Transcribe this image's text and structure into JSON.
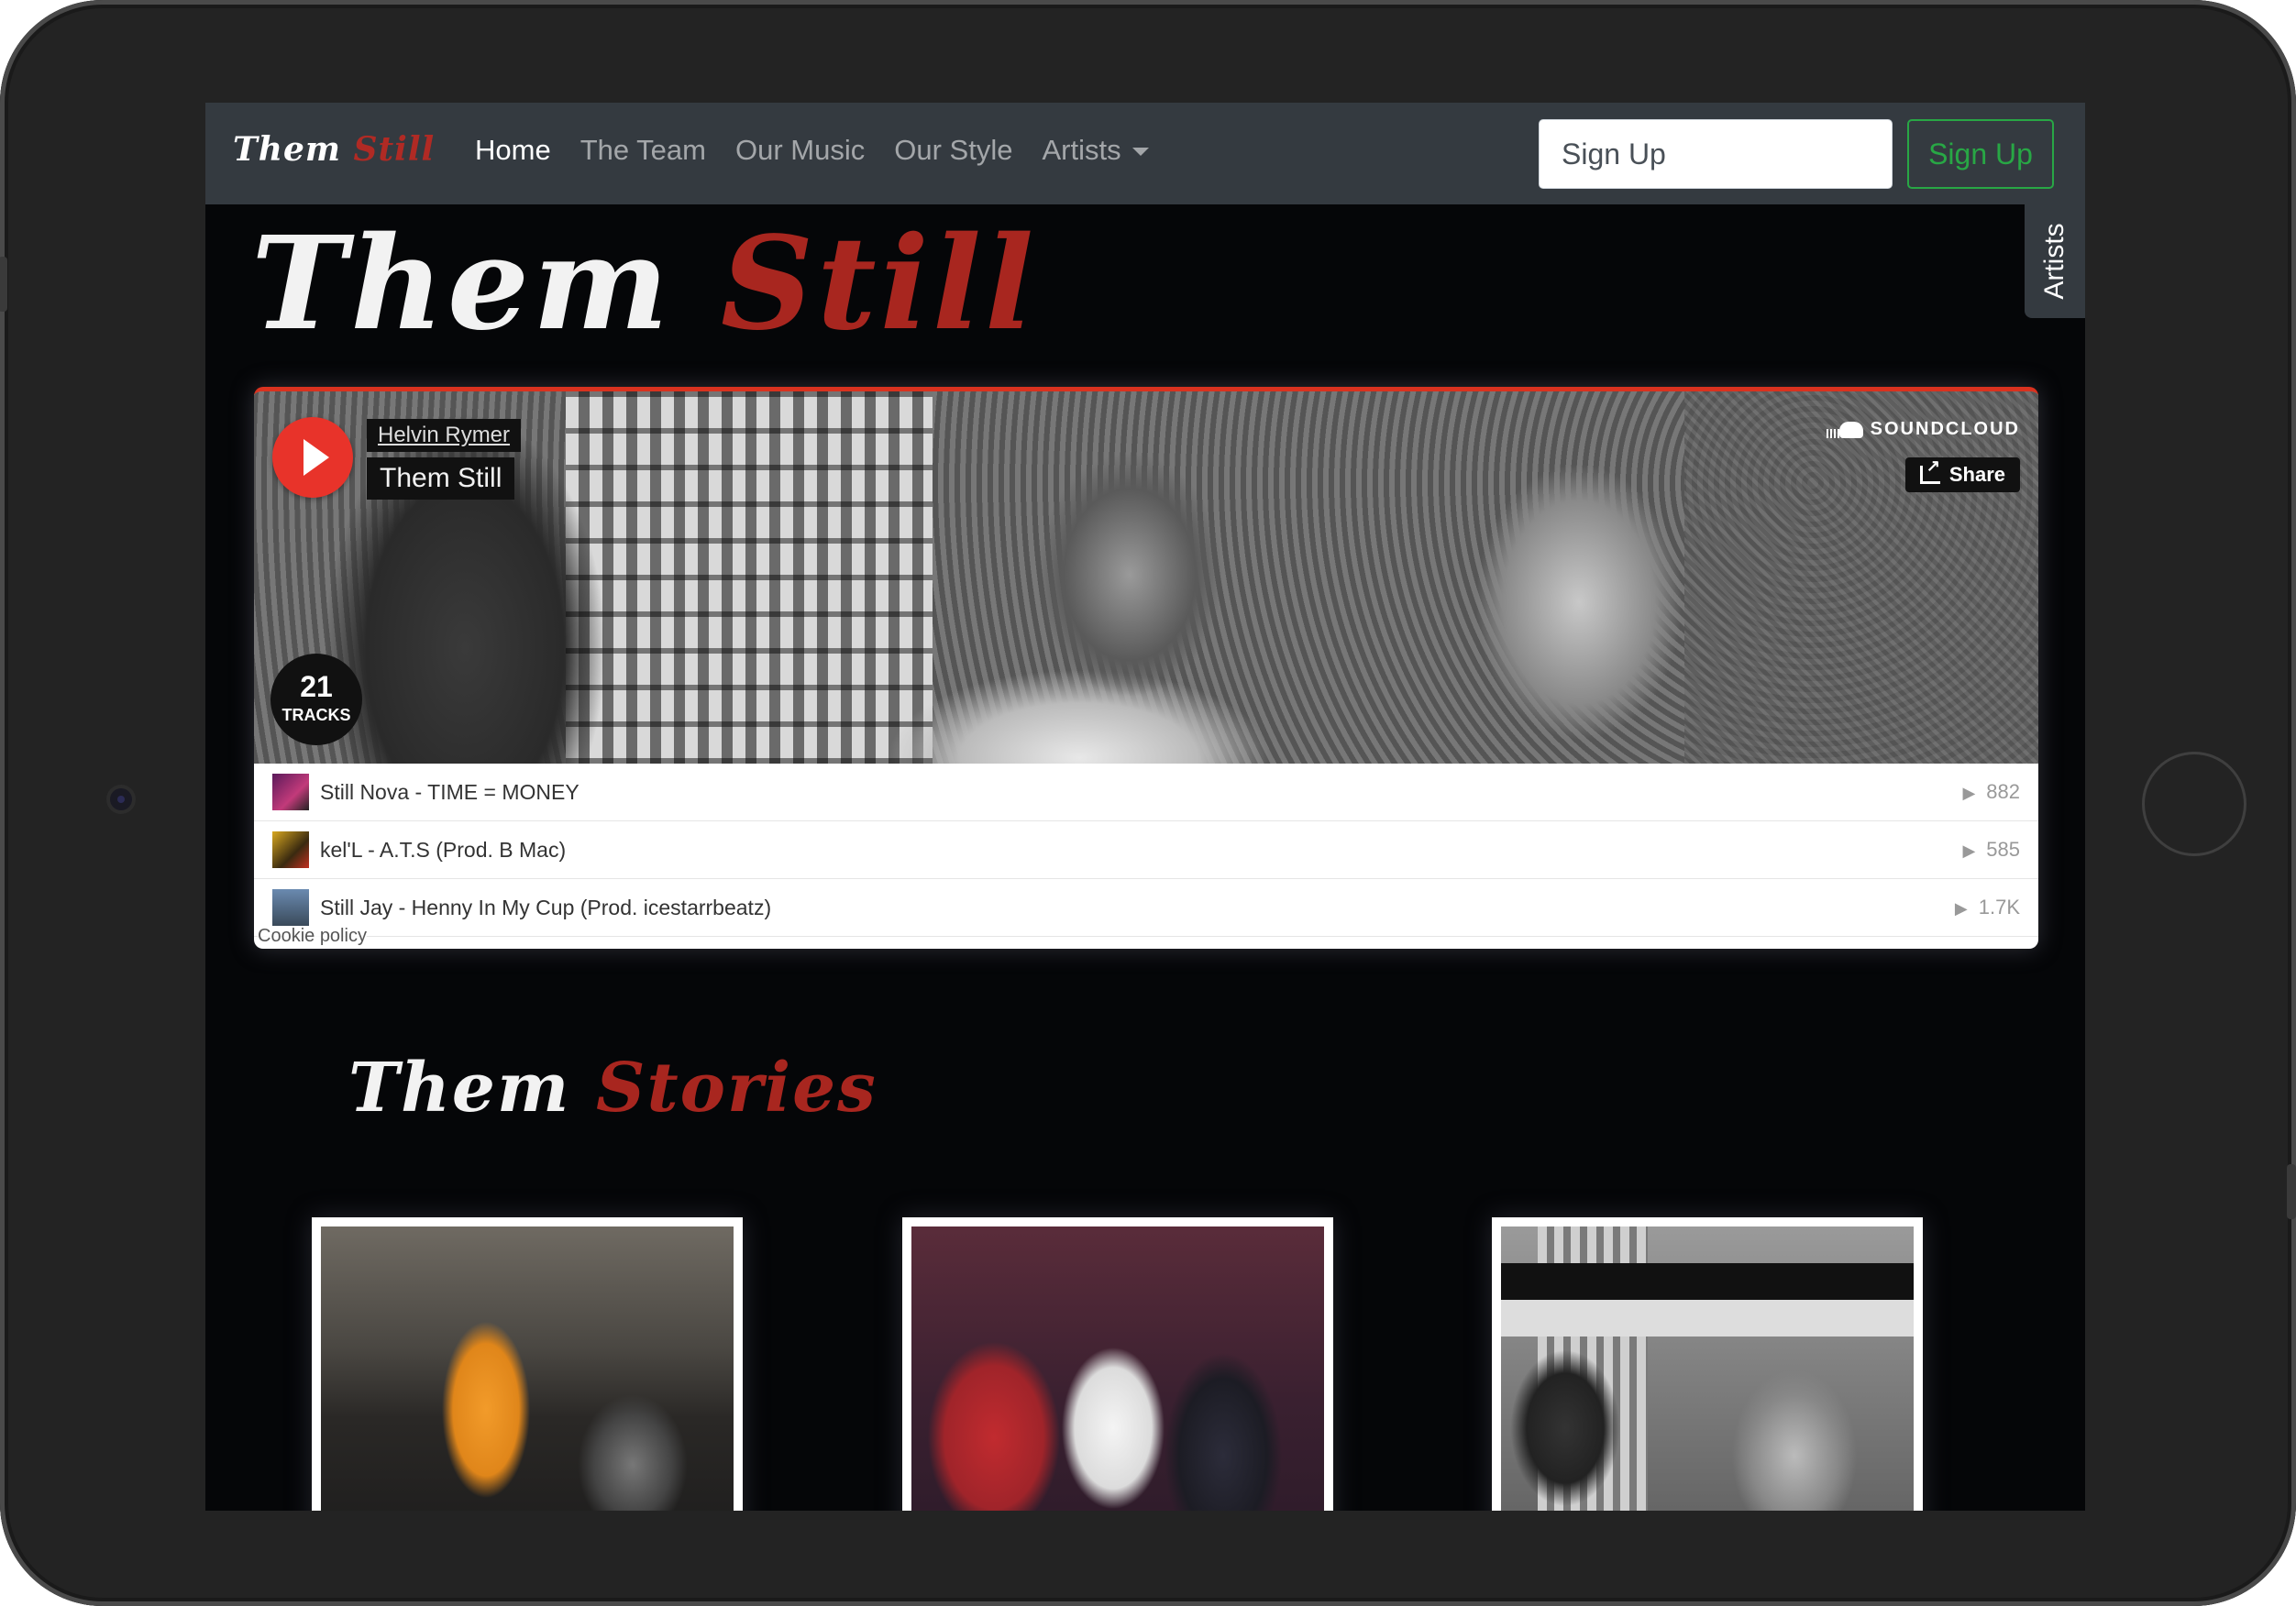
{
  "brand": {
    "first": "Them",
    "second": "Still"
  },
  "nav": {
    "links": [
      {
        "label": "Home",
        "active": true
      },
      {
        "label": "The Team",
        "active": false
      },
      {
        "label": "Our Music",
        "active": false
      },
      {
        "label": "Our Style",
        "active": false
      },
      {
        "label": "Artists",
        "active": false,
        "dropdown": true
      }
    ],
    "signup_placeholder": "Sign Up",
    "signup_button": "Sign Up"
  },
  "side_tab": {
    "label": "Artists"
  },
  "hero": {
    "first": "Them",
    "second": "Still"
  },
  "player": {
    "user": "Helvin Rymer",
    "title": "Them Still",
    "provider": "SOUNDCLOUD",
    "share_label": "Share",
    "track_count": "21",
    "track_count_label": "TRACKS",
    "tracks": [
      {
        "name": "Still Nova - TIME = MONEY",
        "plays": "882"
      },
      {
        "name": "kel'L - A.T.S (Prod. B Mac)",
        "plays": "585"
      },
      {
        "name": "Still Jay - Henny In My Cup (Prod. icestarrbeatz)",
        "plays": "1.7K"
      }
    ],
    "cookie_label": "Cookie policy"
  },
  "stories": {
    "first": "Them",
    "second": "Stories",
    "cards": 3
  },
  "colors": {
    "accent_red": "#a8261f",
    "soundcloud_orange": "#e8332a",
    "success_green": "#28a745",
    "navbar": "#343a40"
  }
}
